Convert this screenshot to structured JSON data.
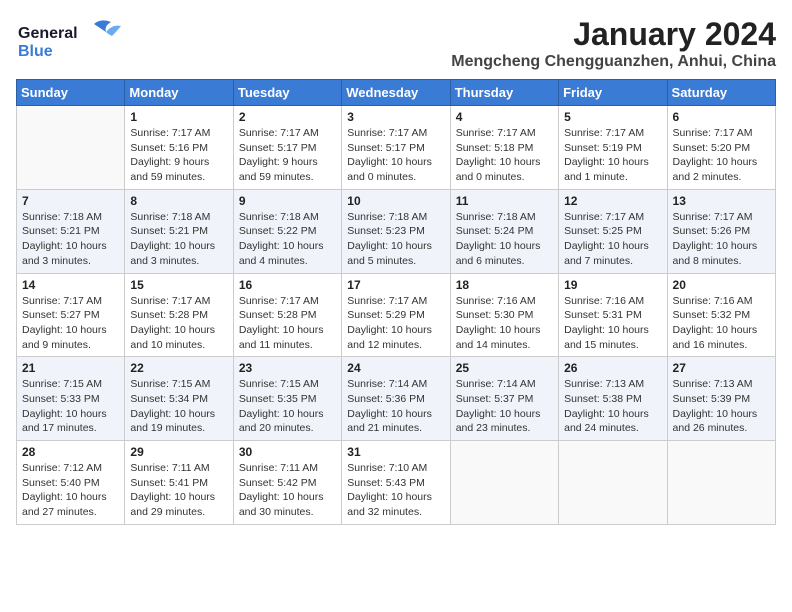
{
  "logo": {
    "line1": "General",
    "line2": "Blue"
  },
  "title": "January 2024",
  "subtitle": "Mengcheng Chengguanzhen, Anhui, China",
  "weekdays": [
    "Sunday",
    "Monday",
    "Tuesday",
    "Wednesday",
    "Thursday",
    "Friday",
    "Saturday"
  ],
  "weeks": [
    [
      {
        "day": "",
        "info": ""
      },
      {
        "day": "1",
        "info": "Sunrise: 7:17 AM\nSunset: 5:16 PM\nDaylight: 9 hours\nand 59 minutes."
      },
      {
        "day": "2",
        "info": "Sunrise: 7:17 AM\nSunset: 5:17 PM\nDaylight: 9 hours\nand 59 minutes."
      },
      {
        "day": "3",
        "info": "Sunrise: 7:17 AM\nSunset: 5:17 PM\nDaylight: 10 hours\nand 0 minutes."
      },
      {
        "day": "4",
        "info": "Sunrise: 7:17 AM\nSunset: 5:18 PM\nDaylight: 10 hours\nand 0 minutes."
      },
      {
        "day": "5",
        "info": "Sunrise: 7:17 AM\nSunset: 5:19 PM\nDaylight: 10 hours\nand 1 minute."
      },
      {
        "day": "6",
        "info": "Sunrise: 7:17 AM\nSunset: 5:20 PM\nDaylight: 10 hours\nand 2 minutes."
      }
    ],
    [
      {
        "day": "7",
        "info": "Sunrise: 7:18 AM\nSunset: 5:21 PM\nDaylight: 10 hours\nand 3 minutes."
      },
      {
        "day": "8",
        "info": "Sunrise: 7:18 AM\nSunset: 5:21 PM\nDaylight: 10 hours\nand 3 minutes."
      },
      {
        "day": "9",
        "info": "Sunrise: 7:18 AM\nSunset: 5:22 PM\nDaylight: 10 hours\nand 4 minutes."
      },
      {
        "day": "10",
        "info": "Sunrise: 7:18 AM\nSunset: 5:23 PM\nDaylight: 10 hours\nand 5 minutes."
      },
      {
        "day": "11",
        "info": "Sunrise: 7:18 AM\nSunset: 5:24 PM\nDaylight: 10 hours\nand 6 minutes."
      },
      {
        "day": "12",
        "info": "Sunrise: 7:17 AM\nSunset: 5:25 PM\nDaylight: 10 hours\nand 7 minutes."
      },
      {
        "day": "13",
        "info": "Sunrise: 7:17 AM\nSunset: 5:26 PM\nDaylight: 10 hours\nand 8 minutes."
      }
    ],
    [
      {
        "day": "14",
        "info": "Sunrise: 7:17 AM\nSunset: 5:27 PM\nDaylight: 10 hours\nand 9 minutes."
      },
      {
        "day": "15",
        "info": "Sunrise: 7:17 AM\nSunset: 5:28 PM\nDaylight: 10 hours\nand 10 minutes."
      },
      {
        "day": "16",
        "info": "Sunrise: 7:17 AM\nSunset: 5:28 PM\nDaylight: 10 hours\nand 11 minutes."
      },
      {
        "day": "17",
        "info": "Sunrise: 7:17 AM\nSunset: 5:29 PM\nDaylight: 10 hours\nand 12 minutes."
      },
      {
        "day": "18",
        "info": "Sunrise: 7:16 AM\nSunset: 5:30 PM\nDaylight: 10 hours\nand 14 minutes."
      },
      {
        "day": "19",
        "info": "Sunrise: 7:16 AM\nSunset: 5:31 PM\nDaylight: 10 hours\nand 15 minutes."
      },
      {
        "day": "20",
        "info": "Sunrise: 7:16 AM\nSunset: 5:32 PM\nDaylight: 10 hours\nand 16 minutes."
      }
    ],
    [
      {
        "day": "21",
        "info": "Sunrise: 7:15 AM\nSunset: 5:33 PM\nDaylight: 10 hours\nand 17 minutes."
      },
      {
        "day": "22",
        "info": "Sunrise: 7:15 AM\nSunset: 5:34 PM\nDaylight: 10 hours\nand 19 minutes."
      },
      {
        "day": "23",
        "info": "Sunrise: 7:15 AM\nSunset: 5:35 PM\nDaylight: 10 hours\nand 20 minutes."
      },
      {
        "day": "24",
        "info": "Sunrise: 7:14 AM\nSunset: 5:36 PM\nDaylight: 10 hours\nand 21 minutes."
      },
      {
        "day": "25",
        "info": "Sunrise: 7:14 AM\nSunset: 5:37 PM\nDaylight: 10 hours\nand 23 minutes."
      },
      {
        "day": "26",
        "info": "Sunrise: 7:13 AM\nSunset: 5:38 PM\nDaylight: 10 hours\nand 24 minutes."
      },
      {
        "day": "27",
        "info": "Sunrise: 7:13 AM\nSunset: 5:39 PM\nDaylight: 10 hours\nand 26 minutes."
      }
    ],
    [
      {
        "day": "28",
        "info": "Sunrise: 7:12 AM\nSunset: 5:40 PM\nDaylight: 10 hours\nand 27 minutes."
      },
      {
        "day": "29",
        "info": "Sunrise: 7:11 AM\nSunset: 5:41 PM\nDaylight: 10 hours\nand 29 minutes."
      },
      {
        "day": "30",
        "info": "Sunrise: 7:11 AM\nSunset: 5:42 PM\nDaylight: 10 hours\nand 30 minutes."
      },
      {
        "day": "31",
        "info": "Sunrise: 7:10 AM\nSunset: 5:43 PM\nDaylight: 10 hours\nand 32 minutes."
      },
      {
        "day": "",
        "info": ""
      },
      {
        "day": "",
        "info": ""
      },
      {
        "day": "",
        "info": ""
      }
    ]
  ]
}
